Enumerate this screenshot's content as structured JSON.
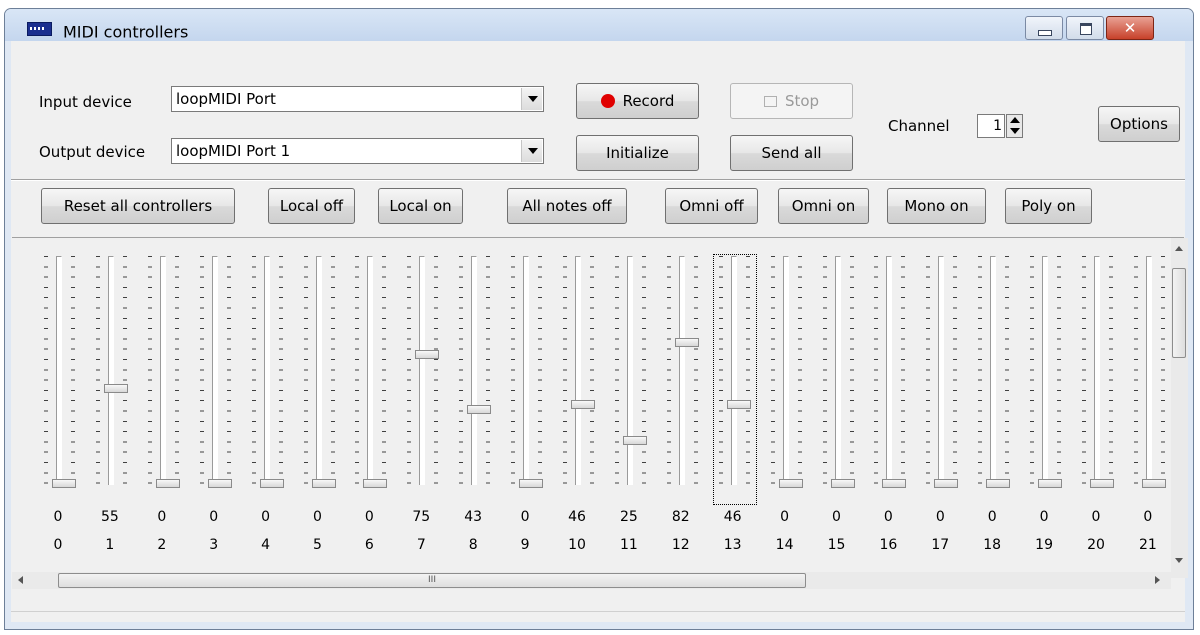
{
  "window": {
    "title": "MIDI controllers"
  },
  "devices": {
    "input_label": "Input device",
    "input_value": "loopMIDI Port",
    "output_label": "Output device",
    "output_value": "loopMIDI Port 1"
  },
  "toolbar": {
    "record_label": "Record",
    "initialize_label": "Initialize",
    "stop_label": "Stop",
    "send_all_label": "Send all",
    "channel_label": "Channel",
    "channel_value": "1",
    "options_label": "Options"
  },
  "commands": [
    "Reset all controllers",
    "Local off",
    "Local on",
    "All notes off",
    "Omni off",
    "Omni on",
    "Mono on",
    "Poly on"
  ],
  "controllers": [
    {
      "id": "0",
      "value": "0"
    },
    {
      "id": "1",
      "value": "55"
    },
    {
      "id": "2",
      "value": "0"
    },
    {
      "id": "3",
      "value": "0"
    },
    {
      "id": "4",
      "value": "0"
    },
    {
      "id": "5",
      "value": "0"
    },
    {
      "id": "6",
      "value": "0"
    },
    {
      "id": "7",
      "value": "75"
    },
    {
      "id": "8",
      "value": "43"
    },
    {
      "id": "9",
      "value": "0"
    },
    {
      "id": "10",
      "value": "46"
    },
    {
      "id": "11",
      "value": "25"
    },
    {
      "id": "12",
      "value": "82"
    },
    {
      "id": "13",
      "value": "46"
    },
    {
      "id": "14",
      "value": "0"
    },
    {
      "id": "15",
      "value": "0"
    },
    {
      "id": "16",
      "value": "0"
    },
    {
      "id": "17",
      "value": "0"
    },
    {
      "id": "18",
      "value": "0"
    },
    {
      "id": "19",
      "value": "0"
    },
    {
      "id": "20",
      "value": "0"
    },
    {
      "id": "21",
      "value": "0"
    }
  ],
  "focused_controller": "13",
  "colors": {
    "record_dot": "#e00000",
    "title_bar": "#c4d6ee",
    "close_button": "#c7412a"
  }
}
